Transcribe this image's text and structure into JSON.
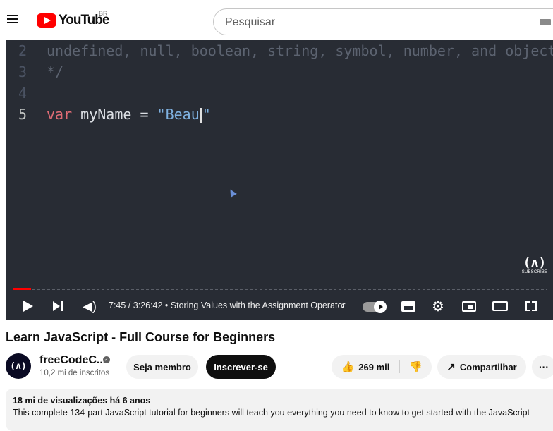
{
  "header": {
    "logo_text": "YouTube",
    "region_code": "BR",
    "search_placeholder": "Pesquisar"
  },
  "player": {
    "code_lines": [
      {
        "number": "2",
        "tokens": [
          {
            "cls": "cm",
            "text": "undefined, null, boolean, string, symbol, number, and object"
          }
        ]
      },
      {
        "number": "3",
        "tokens": [
          {
            "cls": "cm",
            "text": "*/"
          }
        ]
      },
      {
        "number": "4",
        "tokens": []
      },
      {
        "number": "5",
        "tokens": [
          {
            "cls": "kw",
            "text": "var"
          },
          {
            "cls": "id",
            "text": " myName = "
          },
          {
            "cls": "st",
            "text": "\"Beau"
          },
          {
            "cls": "caret",
            "text": ""
          },
          {
            "cls": "st",
            "text": "\""
          }
        ]
      }
    ],
    "active_line": "5",
    "watermark_glyph": "(ʌ)",
    "watermark_label": "SUBSCRIBE",
    "progress_fraction": 0.0344,
    "time_text": "7:45 / 3:26:42 • Storing Values with the Assignment Operator",
    "chapter_arrow": "›",
    "volume_icon": "◀)",
    "settings_icon": "⚙"
  },
  "video": {
    "title": "Learn JavaScript - Full Course for Beginners"
  },
  "channel": {
    "avatar_glyph": "(ʌ)",
    "name": "freeCodeC...",
    "verified_mark": "✓",
    "subscribers": "10,2 mi de inscritos"
  },
  "actions": {
    "member_label": "Seja membro",
    "subscribe_label": "Inscrever-se",
    "like_icon": "👍",
    "likes": "269 mil",
    "dislike_icon": "👎",
    "share_icon": "↗",
    "share_label": "Compartilhar",
    "more_label": "···"
  },
  "description": {
    "meta": "18 mi de visualizações  há 6 anos",
    "text": "This complete 134-part JavaScript tutorial for beginners will teach you everything you need to know to get started with the JavaScript"
  }
}
